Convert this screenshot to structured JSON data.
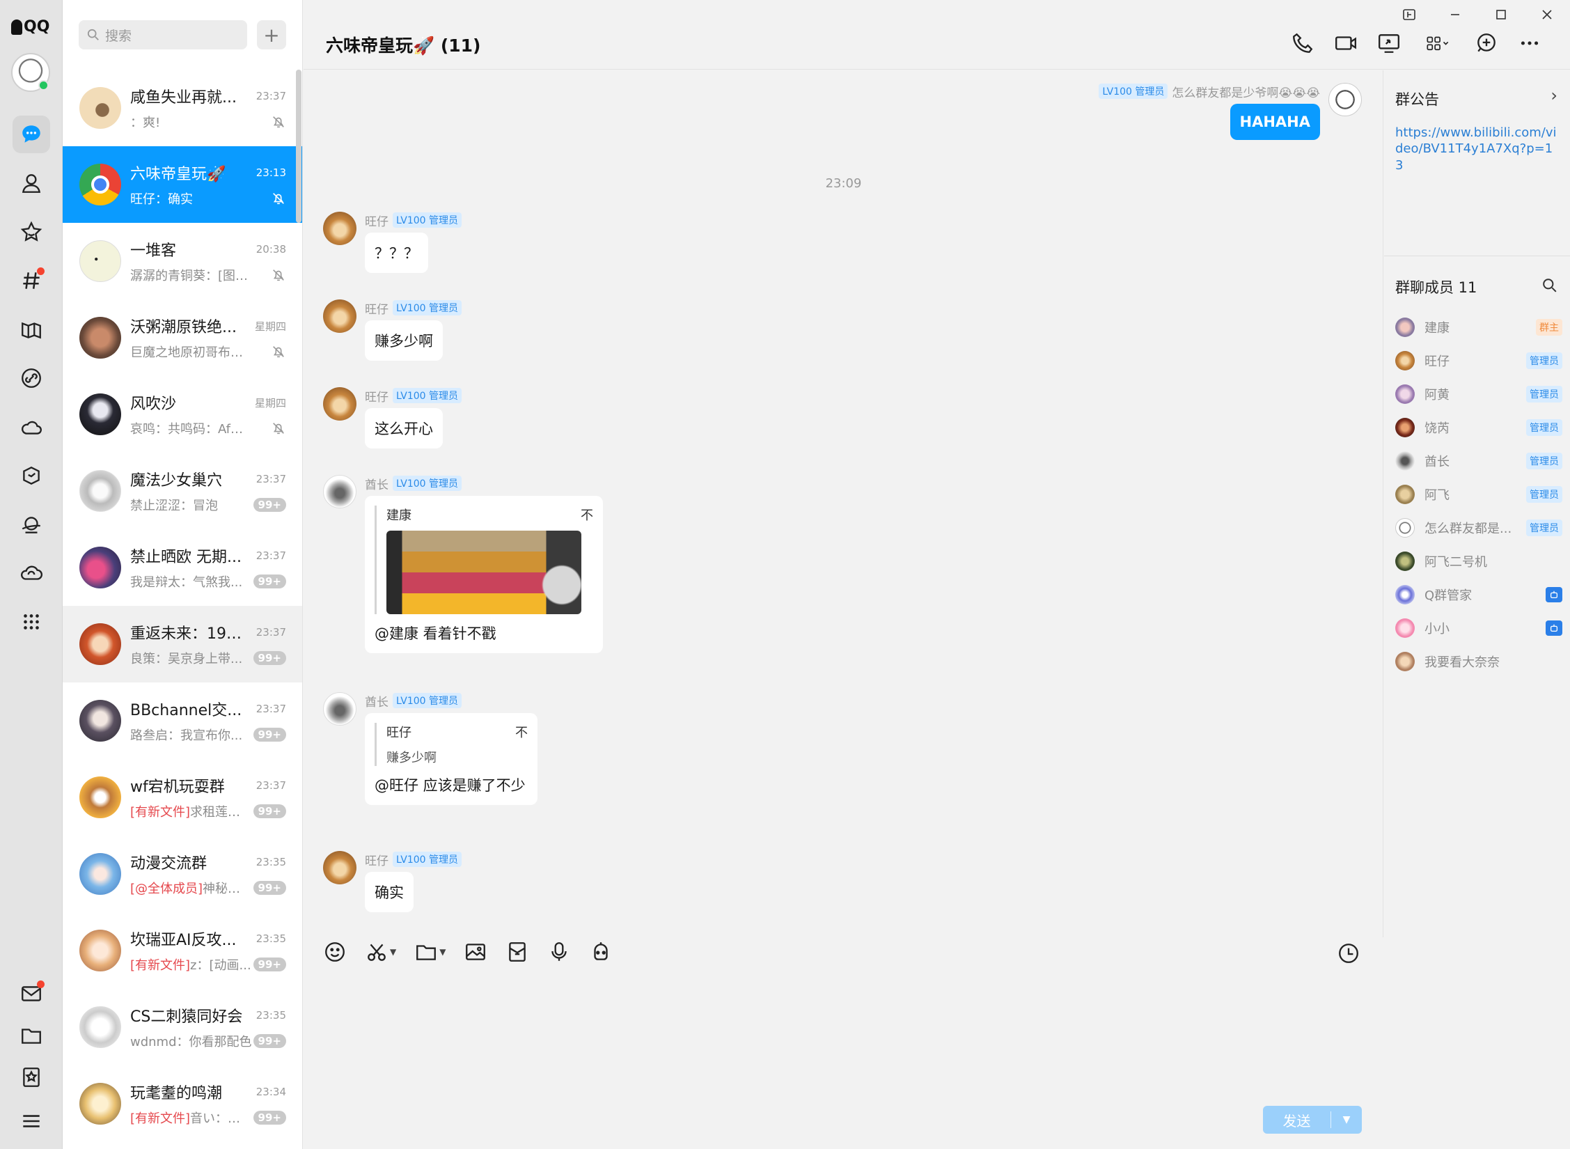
{
  "app": {
    "name": "QQ"
  },
  "window": {
    "title": "六味帝皇玩🚀 (11)"
  },
  "search": {
    "placeholder": "搜索",
    "add": "+"
  },
  "conversations": [
    {
      "name": "咸鱼失业再就...",
      "time": "23:37",
      "msg": "：爽!",
      "tag": "",
      "badge": "",
      "muted": true
    },
    {
      "name": "六味帝皇玩🚀",
      "time": "23:13",
      "msg": "旺仔：确实",
      "tag": "",
      "badge": "",
      "muted": true
    },
    {
      "name": "一堆客",
      "time": "20:38",
      "msg": "潺潺的青铜葵：[图片]",
      "tag": "",
      "badge": "",
      "muted": true
    },
    {
      "name": "沃粥潮原铁绝...",
      "time": "星期四",
      "msg": "巨魔之地原初哥布林：...",
      "tag": "",
      "badge": "",
      "muted": true
    },
    {
      "name": "风吹沙",
      "time": "星期四",
      "msg": "哀鸣：共鸣码：AfQiJA...",
      "tag": "",
      "badge": "",
      "muted": true
    },
    {
      "name": "魔法少女巢穴",
      "time": "23:37",
      "msg": "禁止涩涩：冒泡",
      "tag": "",
      "badge": "99+",
      "muted": false
    },
    {
      "name": "禁止晒欧  无期...",
      "time": "23:37",
      "msg": "我是辩太：气煞我...",
      "tag": "",
      "badge": "99+",
      "muted": false
    },
    {
      "name": "重返未来：199...",
      "time": "23:37",
      "msg": "良策：吴京身上带...",
      "tag": "",
      "badge": "99+",
      "muted": false
    },
    {
      "name": "BBchannel交...",
      "time": "23:37",
      "msg": "路叁启：我宣布你...",
      "tag": "",
      "badge": "99+",
      "muted": false
    },
    {
      "name": "wf宕机玩耍群",
      "time": "23:37",
      "msg": "求租莲花...",
      "tag": "[有新文件]",
      "badge": "99+",
      "muted": false
    },
    {
      "name": "动漫交流群",
      "time": "23:35",
      "msg": "神秘靓...",
      "tag": "[@全体成员]",
      "badge": "99+",
      "muted": false
    },
    {
      "name": "坎瑞亚AI反攻...",
      "time": "23:35",
      "msg": "z：[动画...",
      "tag": "[有新文件]",
      "badge": "99+",
      "muted": false
    },
    {
      "name": "CS二刺猿同好会",
      "time": "23:35",
      "msg": "wdnmd：你看那配色",
      "tag": "",
      "badge": "99+",
      "muted": false
    },
    {
      "name": "玩耄耋的鸣潮",
      "time": "23:34",
      "msg": "音い：非...",
      "tag": "[有新文件]",
      "badge": "99+",
      "muted": false
    }
  ],
  "messages": {
    "me": {
      "level": "LV100 管理员",
      "name": "怎么群友都是少爷啊😭😭😭",
      "text": "HAHAHA"
    },
    "time_separator": "23:09",
    "m1": {
      "name": "旺仔",
      "level": "LV100 管理员",
      "text": "？？？"
    },
    "m2": {
      "name": "旺仔",
      "level": "LV100 管理员",
      "text": "赚多少啊"
    },
    "m3": {
      "name": "旺仔",
      "level": "LV100 管理员",
      "text": "这么开心"
    },
    "m4": {
      "name": "酋长",
      "level": "LV100 管理员",
      "quote_name": "建康",
      "quote_arrow": "不",
      "text": "@建康 看着针不戳"
    },
    "m5": {
      "name": "酋长",
      "level": "LV100 管理员",
      "quote_name": "旺仔",
      "quote_arrow": "不",
      "quote_text": "赚多少啊",
      "text": "@旺仔 应该是赚了不少"
    },
    "m6": {
      "name": "旺仔",
      "level": "LV100 管理员",
      "text": "确实"
    }
  },
  "composer": {
    "send": "发送"
  },
  "panel": {
    "notice_title": "群公告",
    "notice_link": "https://www.bilibili.com/video/BV11T4y1A7Xq?p=13",
    "members_title": "群聊成员 11",
    "members": [
      {
        "name": "建康",
        "role": "群主",
        "kind": "owner"
      },
      {
        "name": "旺仔",
        "role": "管理员",
        "kind": "admin"
      },
      {
        "name": "阿黄",
        "role": "管理员",
        "kind": "admin"
      },
      {
        "name": "饶芮",
        "role": "管理员",
        "kind": "admin"
      },
      {
        "name": "酋长",
        "role": "管理员",
        "kind": "admin"
      },
      {
        "name": "阿飞",
        "role": "管理员",
        "kind": "admin"
      },
      {
        "name": "怎么群友都是...",
        "role": "管理员",
        "kind": "admin"
      },
      {
        "name": "阿飞二号机",
        "role": "",
        "kind": ""
      },
      {
        "name": "Q群管家",
        "role": "",
        "kind": "bot"
      },
      {
        "name": "小小",
        "role": "",
        "kind": "bot"
      },
      {
        "name": "我要看大奈奈",
        "role": "",
        "kind": ""
      }
    ]
  },
  "colors": {
    "accent": "#0a9bff",
    "level_badge_bg": "#d8ecff",
    "level_badge_fg": "#2b8be8",
    "new_tag": "#e5484d"
  }
}
